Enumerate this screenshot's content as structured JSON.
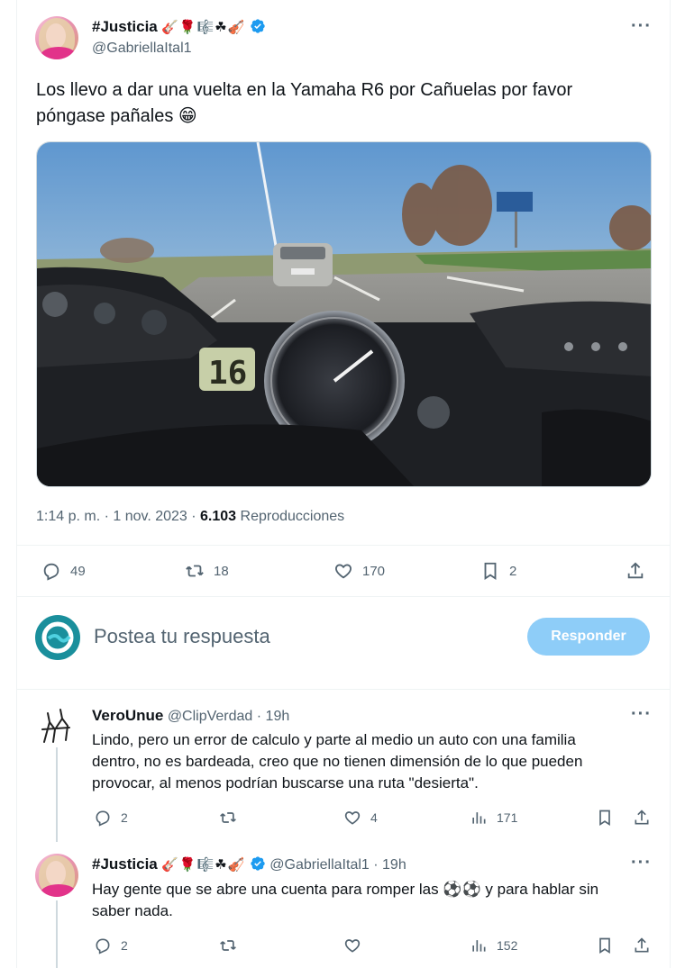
{
  "tweet": {
    "name": "#Justicia",
    "emojis": "🎸🌹🎼☘🎻",
    "handle": "@GabriellaItal1",
    "text_line1": "Los llevo a dar una vuelta en la Yamaha R6 por Cañuelas por favor",
    "text_line2": "póngase pañales 😁",
    "time": "1:14 p. m. · 1 nov. 2023 · ",
    "views_count": "6.103",
    "views_label": " Reproducciones",
    "speedo_readout": "16",
    "actions": {
      "replies": "49",
      "retweets": "18",
      "likes": "170",
      "bookmarks": "2"
    }
  },
  "composer": {
    "placeholder": "Postea tu respuesta",
    "button_label": "Responder"
  },
  "replies": [
    {
      "name": "VeroUnue",
      "handle": "@ClipVerdad",
      "time": " · 19h",
      "text_line1": "Lindo, pero un error de calculo y parte al medio un auto con una familia",
      "text_line2": "dentro, no es bardeada, creo que no tienen dimensión de lo que pueden",
      "text_line3": "provocar, al menos podrían buscarse una ruta \"desierta\".",
      "replies": "2",
      "retweets": "",
      "likes": "4",
      "views": "171"
    },
    {
      "name": "#Justicia",
      "emojis": "🎸🌹🎼☘🎻",
      "handle": "@GabriellaItal1",
      "time": " · 19h",
      "text_line1": "Hay gente que se abre una cuenta para romper las ⚽⚽ y para hablar sin",
      "text_line2": "saber nada.",
      "replies": "2",
      "retweets": "",
      "likes": "",
      "views": "152"
    }
  ],
  "colors": {
    "accent": "#1d9bf0",
    "button_disabled": "#8ecdf8",
    "secondary_text": "#536471"
  }
}
